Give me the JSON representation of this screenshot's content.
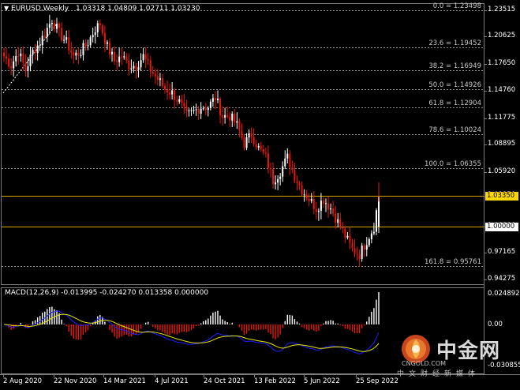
{
  "header": {
    "symbol": "EURUSD,Weekly",
    "ohlc": "1.03318 1.04809 1.02711 1.03230",
    "menu_arrow": "triangle-down-icon"
  },
  "macd_header": "MACD(12,26,9) -0.013995 -0.024270 0.013358 0.000000",
  "price_axis": [
    "1.23515",
    "1.20625",
    "1.17650",
    "1.14760",
    "1.11775",
    "1.08895",
    "1.05920",
    "1.03350",
    "1.00000",
    "0.97165",
    "0.94275"
  ],
  "macd_axis": [
    "0.024892",
    "0.00",
    "-0.030855"
  ],
  "date_axis": [
    "2 Aug 2020",
    "22 Nov 2020",
    "14 Mar 2021",
    "4 Jul 2021",
    "24 Oct 2021",
    "13 Feb 2022",
    "5 Jun 2022",
    "25 Sep 2022"
  ],
  "fib_levels": [
    {
      "label": "0.0 = 1.23498",
      "price": 1.23498
    },
    {
      "label": "23.6 = 1.19452",
      "price": 1.19452
    },
    {
      "label": "38.2 = 1.16949",
      "price": 1.16949
    },
    {
      "label": "50.0 = 1.14926",
      "price": 1.14926
    },
    {
      "label": "61.8 = 1.12904",
      "price": 1.12904
    },
    {
      "label": "78.6 = 1.10024",
      "price": 1.10024
    },
    {
      "label": "100.0 = 1.06355",
      "price": 1.06355
    },
    {
      "label": "161.8 = 0.95761",
      "price": 0.95761
    }
  ],
  "horizontal_lines": [
    {
      "label": "1.03350",
      "price": 1.0335,
      "tag_color": "#ffd700"
    },
    {
      "label": "1.00000",
      "price": 1.0,
      "tag_color": "#ffffff"
    }
  ],
  "colors": {
    "bull": "#ffffff",
    "bear": "#e8160c",
    "hline": "#d4a800",
    "grid": "#3a3a3a",
    "macd_line": "#1e1eff",
    "signal_line": "#e6e600",
    "hist_pos": "#ffffff",
    "hist_neg": "#e8160c"
  },
  "watermark": {
    "brand": "中金网",
    "url": "CNGOLD.COM",
    "tagline": "中文财经新媒体"
  },
  "chart_data": {
    "type": "candlestick",
    "title": "EURUSD,Weekly",
    "price_range": [
      0.9375,
      1.2425
    ],
    "anchors": [
      [
        0,
        1.185
      ],
      [
        3,
        1.175
      ],
      [
        6,
        1.19
      ],
      [
        9,
        1.17
      ],
      [
        12,
        1.19
      ],
      [
        15,
        1.2
      ],
      [
        18,
        1.215
      ],
      [
        20,
        1.225
      ],
      [
        23,
        1.21
      ],
      [
        26,
        1.2
      ],
      [
        29,
        1.185
      ],
      [
        32,
        1.19
      ],
      [
        35,
        1.2
      ],
      [
        38,
        1.215
      ],
      [
        40,
        1.22
      ],
      [
        43,
        1.195
      ],
      [
        46,
        1.18
      ],
      [
        49,
        1.185
      ],
      [
        52,
        1.175
      ],
      [
        55,
        1.175
      ],
      [
        58,
        1.185
      ],
      [
        61,
        1.17
      ],
      [
        64,
        1.16
      ],
      [
        67,
        1.15
      ],
      [
        70,
        1.145
      ],
      [
        73,
        1.135
      ],
      [
        76,
        1.12
      ],
      [
        79,
        1.125
      ],
      [
        82,
        1.13
      ],
      [
        85,
        1.13
      ],
      [
        88,
        1.14
      ],
      [
        91,
        1.12
      ],
      [
        94,
        1.12
      ],
      [
        97,
        1.11
      ],
      [
        100,
        1.09
      ],
      [
        103,
        1.1
      ],
      [
        106,
        1.085
      ],
      [
        109,
        1.075
      ],
      [
        112,
        1.05
      ],
      [
        115,
        1.06
      ],
      [
        118,
        1.075
      ],
      [
        121,
        1.055
      ],
      [
        124,
        1.04
      ],
      [
        127,
        1.03
      ],
      [
        130,
        1.02
      ],
      [
        133,
        1.03
      ],
      [
        136,
        1.02
      ],
      [
        139,
        1.005
      ],
      [
        142,
        0.99
      ],
      [
        145,
        0.975
      ],
      [
        148,
        0.97
      ],
      [
        151,
        0.985
      ],
      [
        154,
        1.0
      ],
      [
        156,
        1.0332
      ]
    ]
  }
}
